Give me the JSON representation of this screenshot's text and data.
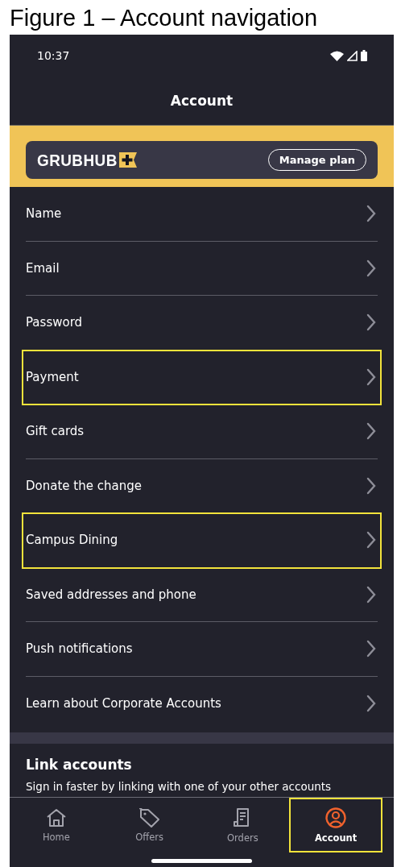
{
  "caption": "Figure 1 – Account navigation",
  "status_bar": {
    "time": "10:37"
  },
  "header": {
    "title": "Account"
  },
  "plan_banner": {
    "logo": "GRUBHUB",
    "button": "Manage plan"
  },
  "menu": [
    {
      "label": "Name",
      "highlighted": false
    },
    {
      "label": "Email",
      "highlighted": false
    },
    {
      "label": "Password",
      "highlighted": false
    },
    {
      "label": "Payment",
      "highlighted": true
    },
    {
      "label": "Gift cards",
      "highlighted": false
    },
    {
      "label": "Donate the change",
      "highlighted": false
    },
    {
      "label": "Campus Dining",
      "highlighted": true
    },
    {
      "label": "Saved addresses and phone",
      "highlighted": false
    },
    {
      "label": "Push notifications",
      "highlighted": false
    },
    {
      "label": "Learn about Corporate Accounts",
      "highlighted": false
    }
  ],
  "link_accounts": {
    "title": "Link accounts",
    "text": "Sign in faster by linking with one of your other accounts"
  },
  "tabs": [
    {
      "label": "Home",
      "kind": "home",
      "selected": false,
      "highlighted": false
    },
    {
      "label": "Offers",
      "kind": "offers",
      "selected": false,
      "highlighted": false
    },
    {
      "label": "Orders",
      "kind": "orders",
      "selected": false,
      "highlighted": false
    },
    {
      "label": "Account",
      "kind": "account",
      "selected": true,
      "highlighted": true
    }
  ]
}
